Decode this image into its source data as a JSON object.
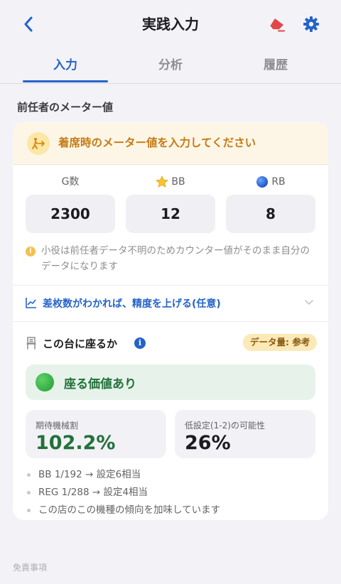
{
  "header": {
    "title": "実践入力"
  },
  "tabs": [
    {
      "label": "入力",
      "active": true
    },
    {
      "label": "分析",
      "active": false
    },
    {
      "label": "履歴",
      "active": false
    }
  ],
  "section_label": "前任者のメーター値",
  "prompt": {
    "text": "着席時のメーター値を入力してください"
  },
  "counters": [
    {
      "label": "G数",
      "value": "2300",
      "icon": ""
    },
    {
      "label": "BB",
      "value": "12",
      "icon": "star-icon"
    },
    {
      "label": "RB",
      "value": "8",
      "icon": "blue-ball-icon"
    }
  ],
  "note": "小役は前任者データ不明のためカウンター値がそのまま自分のデータになります",
  "accuracy_link": "差枚数がわかれば、精度を上げる(任意)",
  "sit": {
    "title": "この台に座るか",
    "badge": "データ量: 参考",
    "verdict": "座る価値あり"
  },
  "stats": [
    {
      "label": "期待機械割",
      "value": "102.2%",
      "color": "#23713a"
    },
    {
      "label": "低設定(1-2)の可能性",
      "value": "26%",
      "color": "#1c1c1e"
    }
  ],
  "bullets": [
    "BB 1/192 → 設定6相当",
    "REG 1/288 → 設定4相当",
    "この店のこの機種の傾向を加味しています"
  ],
  "footer": "免責事項",
  "colors": {
    "accent": "#2563c9",
    "warning": "#c67a12",
    "success": "#23713a",
    "eraser": "#e0484a"
  }
}
